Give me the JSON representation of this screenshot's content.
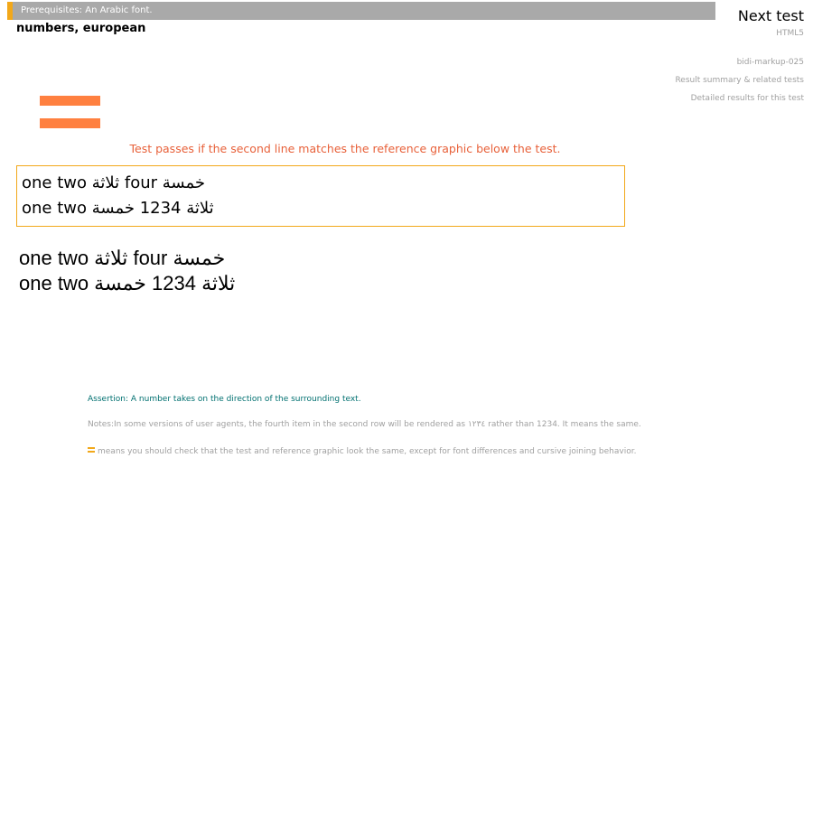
{
  "header": {
    "prerequisites": "Prerequisites: An Arabic font.",
    "title": "numbers, european",
    "next_test": "Next test",
    "spec": "HTML5",
    "test_id": "bidi-markup-025",
    "result_summary": "Result summary & related tests",
    "detailed_results": "Detailed results for this test"
  },
  "main": {
    "icon": "equals-icon",
    "instructions": "Test passes if the second line matches the reference graphic below the test.",
    "test_lines": [
      "one two ثلاثة four خمسة",
      "one two ثلاثة 1234 خمسة"
    ],
    "reference_lines": [
      "one two ثلاثة four خمسة",
      "one two ثلاثة 1234 خمسة"
    ]
  },
  "footer": {
    "assertion": "Assertion: A number takes on the direction of the surrounding text.",
    "notes": "Notes:In some versions of user agents, the fourth item in the second row will be rendered as ١٢٣٤ rather than 1234. It means the same.",
    "equals_note": "means you should check that the test and reference graphic look the same, except for font differences and cursive joining behavior."
  },
  "colors": {
    "prereq_bar": "#a9a9a9",
    "prereq_accent": "#f2a81a",
    "icon": "#ff8040",
    "instructions": "#e8613a",
    "assertion": "#007070",
    "muted": "#a0a0a0"
  }
}
